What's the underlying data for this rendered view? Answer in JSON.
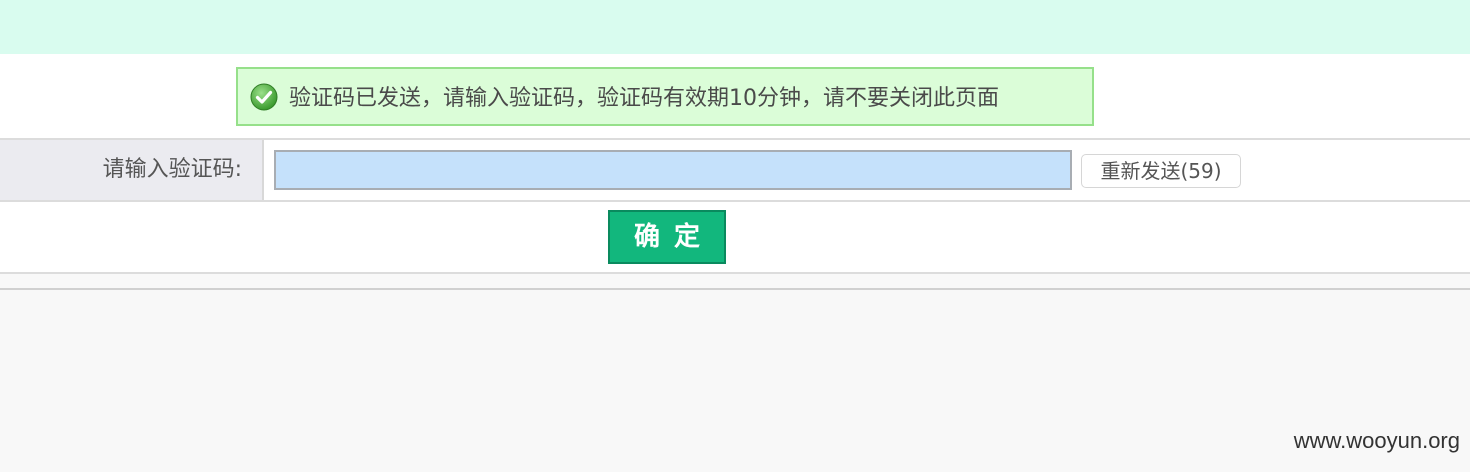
{
  "notice": {
    "icon": "check-circle-icon",
    "message": "验证码已发送，请输入验证码，验证码有效期10分钟，请不要关闭此页面",
    "background": "#dbfdd8",
    "border": "#96e08a"
  },
  "form": {
    "code_label": "请输入验证码:",
    "code_value": "",
    "resend_label": "重新发送(59)",
    "confirm_label": "确定"
  },
  "colors": {
    "top_band": "#d9fcef",
    "confirm_button": "#12b77d",
    "input_background": "#c5e1fb"
  },
  "watermark": "www.wooyun.org"
}
